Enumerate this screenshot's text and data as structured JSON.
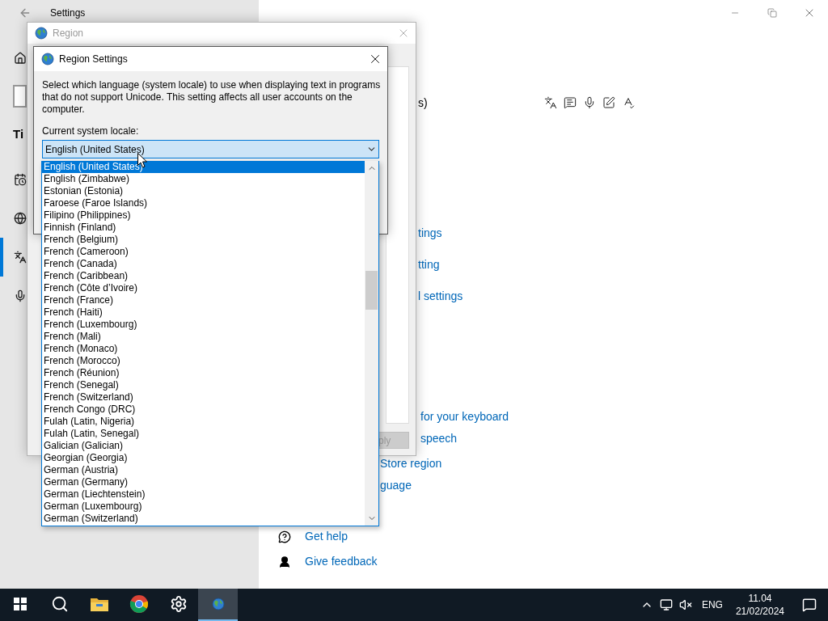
{
  "settings_window": {
    "title": "Settings",
    "sidebar": {
      "heading": "Ti",
      "items": [
        {
          "kind": "calendar",
          "selected": false
        },
        {
          "kind": "globe",
          "selected": false
        },
        {
          "kind": "language",
          "selected": true
        },
        {
          "kind": "microphone",
          "selected": false
        }
      ]
    },
    "language_fragment": "s)",
    "related_links": [
      "tings",
      "tting",
      "l settings"
    ],
    "keyboard_links": [
      "for your keyboard",
      "speech"
    ],
    "language_links": [
      "Store region",
      "guage"
    ],
    "help_links": [
      {
        "kind": "help",
        "label": "Get help"
      },
      {
        "kind": "feedback",
        "label": "Give feedback"
      }
    ]
  },
  "region_window": {
    "title": "Region",
    "apply_label": "ply",
    "apply_disabled": true
  },
  "region_settings_dialog": {
    "title": "Region Settings",
    "description": "Select which language (system locale) to use when displaying text in programs that do not support Unicode. This setting affects all user accounts on the computer.",
    "locale_label": "Current system locale:",
    "locale_value": "English (United States)",
    "dropdown": {
      "expanded": true,
      "options": [
        {
          "label": "English (United States)",
          "selected": true
        },
        {
          "label": "English (Zimbabwe)",
          "selected": false
        },
        {
          "label": "Estonian (Estonia)",
          "selected": false
        },
        {
          "label": "Faroese (Faroe Islands)",
          "selected": false
        },
        {
          "label": "Filipino (Philippines)",
          "selected": false
        },
        {
          "label": "Finnish (Finland)",
          "selected": false
        },
        {
          "label": "French (Belgium)",
          "selected": false
        },
        {
          "label": "French (Cameroon)",
          "selected": false
        },
        {
          "label": "French (Canada)",
          "selected": false
        },
        {
          "label": "French (Caribbean)",
          "selected": false
        },
        {
          "label": "French (Côte d’Ivoire)",
          "selected": false
        },
        {
          "label": "French (France)",
          "selected": false
        },
        {
          "label": "French (Haiti)",
          "selected": false
        },
        {
          "label": "French (Luxembourg)",
          "selected": false
        },
        {
          "label": "French (Mali)",
          "selected": false
        },
        {
          "label": "French (Monaco)",
          "selected": false
        },
        {
          "label": "French (Morocco)",
          "selected": false
        },
        {
          "label": "French (Réunion)",
          "selected": false
        },
        {
          "label": "French (Senegal)",
          "selected": false
        },
        {
          "label": "French (Switzerland)",
          "selected": false
        },
        {
          "label": "French Congo (DRC)",
          "selected": false
        },
        {
          "label": "Fulah (Latin, Nigeria)",
          "selected": false
        },
        {
          "label": "Fulah (Latin, Senegal)",
          "selected": false
        },
        {
          "label": "Galician (Galician)",
          "selected": false
        },
        {
          "label": "Georgian (Georgia)",
          "selected": false
        },
        {
          "label": "German (Austria)",
          "selected": false
        },
        {
          "label": "German (Germany)",
          "selected": false
        },
        {
          "label": "German (Liechtenstein)",
          "selected": false
        },
        {
          "label": "German (Luxembourg)",
          "selected": false
        },
        {
          "label": "German (Switzerland)",
          "selected": false
        }
      ]
    }
  },
  "taskbar": {
    "apps": [
      {
        "kind": "start",
        "active": false
      },
      {
        "kind": "search",
        "active": false
      },
      {
        "kind": "explorer",
        "active": false
      },
      {
        "kind": "chrome",
        "active": false
      },
      {
        "kind": "settings",
        "active": false
      },
      {
        "kind": "region",
        "active": true
      }
    ],
    "tray": {
      "language": "ENG",
      "time": "11.04",
      "date": "21/02/2024"
    }
  }
}
